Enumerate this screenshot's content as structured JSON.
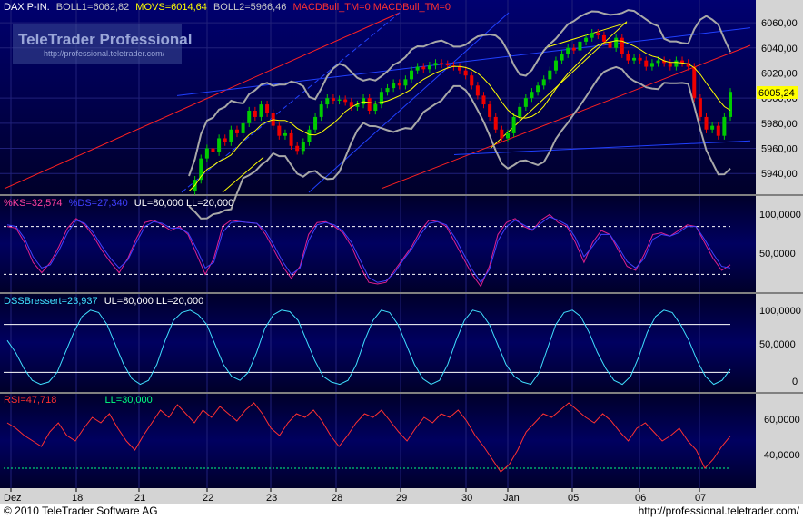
{
  "colors": {
    "panel_top": "#000060",
    "panel_bottom": "#00003a",
    "axis_bg": "#d8d8d8",
    "grid": "#20207a",
    "candle_up": "#00cc00",
    "candle_down": "#ee0000",
    "boll": "#a8a8a8",
    "movs": "#ffff00",
    "trend_red": "#ff2020",
    "trend_blue": "#2040ff",
    "stoch_k": "#e0208c",
    "stoch_d": "#4040ff",
    "dss": "#40e0ff",
    "rsi": "#ff3030",
    "ll_line": "#00ff80",
    "ul_line": "#ffffff"
  },
  "watermark": {
    "title": "TeleTrader Professional",
    "url": "http://professional.teletrader.com/"
  },
  "panels": {
    "price": {
      "label_name": "DAX P-IN.",
      "label_boll1": "BOLL1=6062,82",
      "label_movs": "MOVS=6014,64",
      "label_boll2": "BOLL2=5966,46",
      "label_macd": "MACDBull_TM=0 MACDBull_TM=0",
      "last_value": "6005,24",
      "ticks": [
        "6060,00",
        "6040,00",
        "6020,00",
        "6000,00",
        "5980,00",
        "5960,00",
        "5940,00"
      ]
    },
    "stoch": {
      "label_k": "%KS=32,574",
      "label_d": "%DS=27,340",
      "label_levels": "UL=80,000 LL=20,000",
      "ticks": [
        "100,0000",
        "50,0000"
      ]
    },
    "dss": {
      "label_main": "DSSBressert=23,937",
      "label_levels": "UL=80,000 LL=20,000",
      "ticks": [
        "100,0000",
        "50,0000",
        "0"
      ]
    },
    "rsi": {
      "label_main": "RSI=47,718",
      "label_ll": "LL=30,000",
      "ticks": [
        "60,0000",
        "40,0000"
      ]
    }
  },
  "x_axis": {
    "labels": [
      "Dez",
      "18",
      "21",
      "22",
      "23",
      "28",
      "29",
      "30",
      "Jan",
      "05",
      "06",
      "07"
    ]
  },
  "footer": {
    "copyright": "© 2010 TeleTrader Software AG",
    "url": "http://professional.teletrader.com/"
  },
  "chart_data": [
    {
      "type": "candlestick",
      "title": "DAX P-IN.",
      "ylim": [
        5925,
        6068
      ],
      "series": [
        {
          "name": "BOLL1",
          "last": 6062.82
        },
        {
          "name": "MOVS",
          "last": 6014.64
        },
        {
          "name": "BOLL2",
          "last": 5966.46
        }
      ],
      "close_path": [
        5926,
        5935,
        5952,
        5960,
        5957,
        5968,
        5965,
        5975,
        5972,
        5980,
        5990,
        5985,
        5995,
        5988,
        5978,
        5970,
        5972,
        5962,
        5958,
        5965,
        5975,
        5985,
        5995,
        6000,
        5998,
        5999,
        5997,
        5993,
        5995,
        6000,
        5990,
        5995,
        6005,
        6008,
        6012,
        6010,
        6015,
        6022,
        6025,
        6023,
        6026,
        6028,
        6027,
        6026,
        6025,
        6022,
        6018,
        6010,
        6002,
        5995,
        5985,
        5975,
        5968,
        5972,
        5985,
        5993,
        6000,
        6005,
        6010,
        6015,
        6022,
        6030,
        6035,
        6040,
        6038,
        6045,
        6048,
        6052,
        6050,
        6045,
        6040,
        6048,
        6035,
        6030,
        6032,
        6030,
        6025,
        6028,
        6030,
        6028,
        6025,
        6030,
        6028,
        6025,
        6000,
        5985,
        5975,
        5978,
        5970,
        5985,
        6005
      ]
    },
    {
      "type": "line",
      "title": "%KS / %DS",
      "ylim": [
        0,
        100
      ],
      "levels": {
        "UL": 80,
        "LL": 20
      },
      "series": [
        {
          "name": "%KS",
          "last": 32.574,
          "values": [
            80,
            78,
            60,
            35,
            22,
            35,
            55,
            78,
            90,
            82,
            68,
            50,
            35,
            22,
            40,
            65,
            85,
            88,
            82,
            75,
            80,
            70,
            45,
            20,
            40,
            80,
            88,
            86,
            85,
            84,
            70,
            50,
            30,
            15,
            30,
            70,
            85,
            86,
            80,
            72,
            55,
            30,
            10,
            8,
            10,
            25,
            40,
            55,
            75,
            88,
            86,
            80,
            60,
            40,
            20,
            5,
            30,
            70,
            85,
            90,
            80,
            75,
            88,
            95,
            85,
            80,
            60,
            35,
            60,
            75,
            70,
            50,
            30,
            25,
            45,
            70,
            72,
            68,
            75,
            82,
            80,
            60,
            40,
            25,
            32
          ]
        },
        {
          "name": "%DS",
          "last": 27.34,
          "values": [
            82,
            80,
            65,
            42,
            28,
            32,
            50,
            72,
            88,
            84,
            72,
            55,
            40,
            28,
            38,
            60,
            80,
            86,
            84,
            78,
            78,
            72,
            52,
            28,
            35,
            72,
            85,
            86,
            85,
            84,
            74,
            56,
            36,
            20,
            28,
            62,
            82,
            85,
            82,
            74,
            60,
            38,
            16,
            10,
            12,
            22,
            38,
            52,
            70,
            84,
            86,
            82,
            66,
            46,
            26,
            10,
            26,
            62,
            80,
            88,
            82,
            76,
            84,
            92,
            88,
            82,
            66,
            42,
            55,
            70,
            70,
            54,
            36,
            28,
            40,
            64,
            70,
            68,
            72,
            80,
            80,
            64,
            46,
            30,
            28
          ]
        }
      ]
    },
    {
      "type": "line",
      "title": "DSSBressert",
      "ylim": [
        0,
        100
      ],
      "levels": {
        "UL": 80,
        "LL": 20
      },
      "series": [
        {
          "name": "DSSBressert",
          "last": 23.937,
          "values": [
            60,
            45,
            25,
            10,
            5,
            8,
            20,
            45,
            70,
            90,
            98,
            95,
            80,
            55,
            30,
            12,
            5,
            10,
            30,
            60,
            85,
            95,
            98,
            92,
            80,
            55,
            30,
            15,
            10,
            20,
            45,
            75,
            92,
            98,
            96,
            85,
            60,
            35,
            15,
            8,
            5,
            10,
            30,
            60,
            85,
            98,
            95,
            80,
            55,
            30,
            12,
            5,
            10,
            30,
            60,
            85,
            98,
            95,
            80,
            55,
            30,
            15,
            8,
            5,
            20,
            50,
            80,
            95,
            98,
            90,
            70,
            45,
            25,
            10,
            5,
            15,
            40,
            70,
            90,
            98,
            95,
            80,
            60,
            35,
            15,
            5,
            10,
            24
          ]
        }
      ]
    },
    {
      "type": "line",
      "title": "RSI",
      "ylim": [
        20,
        68
      ],
      "levels": {
        "LL": 30
      },
      "series": [
        {
          "name": "RSI",
          "last": 47.718,
          "values": [
            55,
            52,
            48,
            45,
            42,
            50,
            55,
            48,
            45,
            52,
            58,
            55,
            60,
            52,
            45,
            40,
            48,
            55,
            62,
            58,
            65,
            60,
            55,
            62,
            58,
            64,
            60,
            56,
            62,
            66,
            60,
            52,
            48,
            55,
            60,
            58,
            62,
            56,
            48,
            42,
            48,
            55,
            60,
            58,
            62,
            56,
            50,
            45,
            52,
            58,
            55,
            60,
            58,
            62,
            56,
            48,
            42,
            35,
            28,
            32,
            40,
            50,
            55,
            60,
            58,
            62,
            66,
            62,
            58,
            55,
            60,
            56,
            50,
            45,
            52,
            55,
            50,
            45,
            48,
            52,
            45,
            40,
            30,
            35,
            42,
            47.718
          ]
        }
      ]
    }
  ]
}
